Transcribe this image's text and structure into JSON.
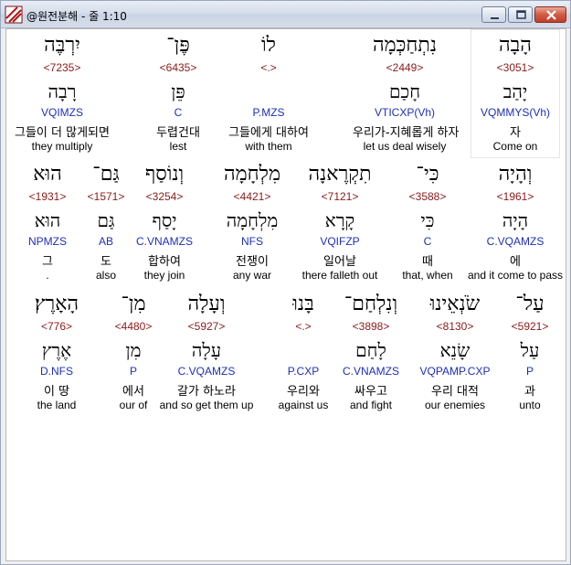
{
  "window": {
    "title": "@원전분해 - 줄 1:10",
    "icon": "diagonal-stripes-icon"
  },
  "rows": [
    [
      {
        "heb": "הָבָה",
        "strong": "<3051>",
        "lex": "יָהַב",
        "morph": "VQMMYS(Vh)",
        "kor": "자",
        "eng": "Come on",
        "selected": true
      },
      {
        "heb": "נִתְחַכְּמָה",
        "strong": "<2449>",
        "lex": "חָכַם",
        "morph": "VTICXP(Vh)",
        "kor": "우리가-지혜롭게 하자",
        "eng": "let us deal wisely"
      },
      {
        "heb": "לוֹ",
        "strong": "<.>",
        "lex": "",
        "morph": "P.MZS",
        "kor": "그들에게 대하여",
        "eng": "with them"
      },
      {
        "heb": "פֶּן־",
        "strong": "<6435>",
        "lex": "פֵּן",
        "morph": "C",
        "kor": "두렵건대",
        "eng": "lest"
      },
      {
        "heb": "יִרְבֶּה",
        "strong": "<7235>",
        "lex": "רָבָה",
        "morph": "VQIMZS",
        "kor": "그들이 더 많게되면",
        "eng": "they multiply"
      }
    ],
    [
      {
        "heb": "וְהָיָה",
        "strong": "<1961>",
        "lex": "הָיָה",
        "morph": "C.VQAMZS",
        "kor": "에",
        "eng": "and it come to pass"
      },
      {
        "heb": "כִּי־",
        "strong": "<3588>",
        "lex": "כִּי",
        "morph": "C",
        "kor": "때",
        "eng": "that, when"
      },
      {
        "heb": "תִקְרֶאנָה",
        "strong": "<7121>",
        "lex": "קָרָא",
        "morph": "VQIFZP",
        "kor": "일어날",
        "eng": "there falleth out"
      },
      {
        "heb": "מִלְחָמָה",
        "strong": "<4421>",
        "lex": "מִלְחָמָה",
        "morph": "NFS",
        "kor": "전쟁이",
        "eng": "any war"
      },
      {
        "heb": "וְנוֹסַף",
        "strong": "<3254>",
        "lex": "יָסַף",
        "morph": "C.VNAMZS",
        "kor": "합하여",
        "eng": "they join"
      },
      {
        "heb": "גַּם־",
        "strong": "<1571>",
        "lex": "גַּם",
        "morph": "AB",
        "kor": "도",
        "eng": "also"
      },
      {
        "heb": "הוּא",
        "strong": "<1931>",
        "lex": "הוּא",
        "morph": "NPMZS",
        "kor": "그",
        "eng": "."
      }
    ],
    [
      {
        "heb": "עַל־",
        "strong": "<5921>",
        "lex": "עַל",
        "morph": "P",
        "kor": "과",
        "eng": "unto"
      },
      {
        "heb": "שֹׂנְאֵינוּ",
        "strong": "<8130>",
        "lex": "שָׂנֵא",
        "morph": "VQPAMP.CXP",
        "kor": "우리 대적",
        "eng": "our enemies"
      },
      {
        "heb": "וְנִלְחַם־",
        "strong": "<3898>",
        "lex": "לָחַם",
        "morph": "C.VNAMZS",
        "kor": "싸우고",
        "eng": "and fight"
      },
      {
        "heb": "בָּנוּ",
        "strong": "<.>",
        "lex": "",
        "morph": "P.CXP",
        "kor": "우리와",
        "eng": "against us"
      },
      {
        "heb": "וְעָלָה",
        "strong": "<5927>",
        "lex": "עָלָה",
        "morph": "C.VQAMZS",
        "kor": "갈가 하노라",
        "eng": "and so get them up"
      },
      {
        "heb": "מִן־",
        "strong": "<4480>",
        "lex": "מִן",
        "morph": "P",
        "kor": "에서",
        "eng": "our of"
      },
      {
        "heb": "הָאָרֶץ׃",
        "strong": "<776>",
        "lex": "אֶרֶץ",
        "morph": "D.NFS",
        "kor": "이 땅",
        "eng": "the land"
      }
    ]
  ]
}
